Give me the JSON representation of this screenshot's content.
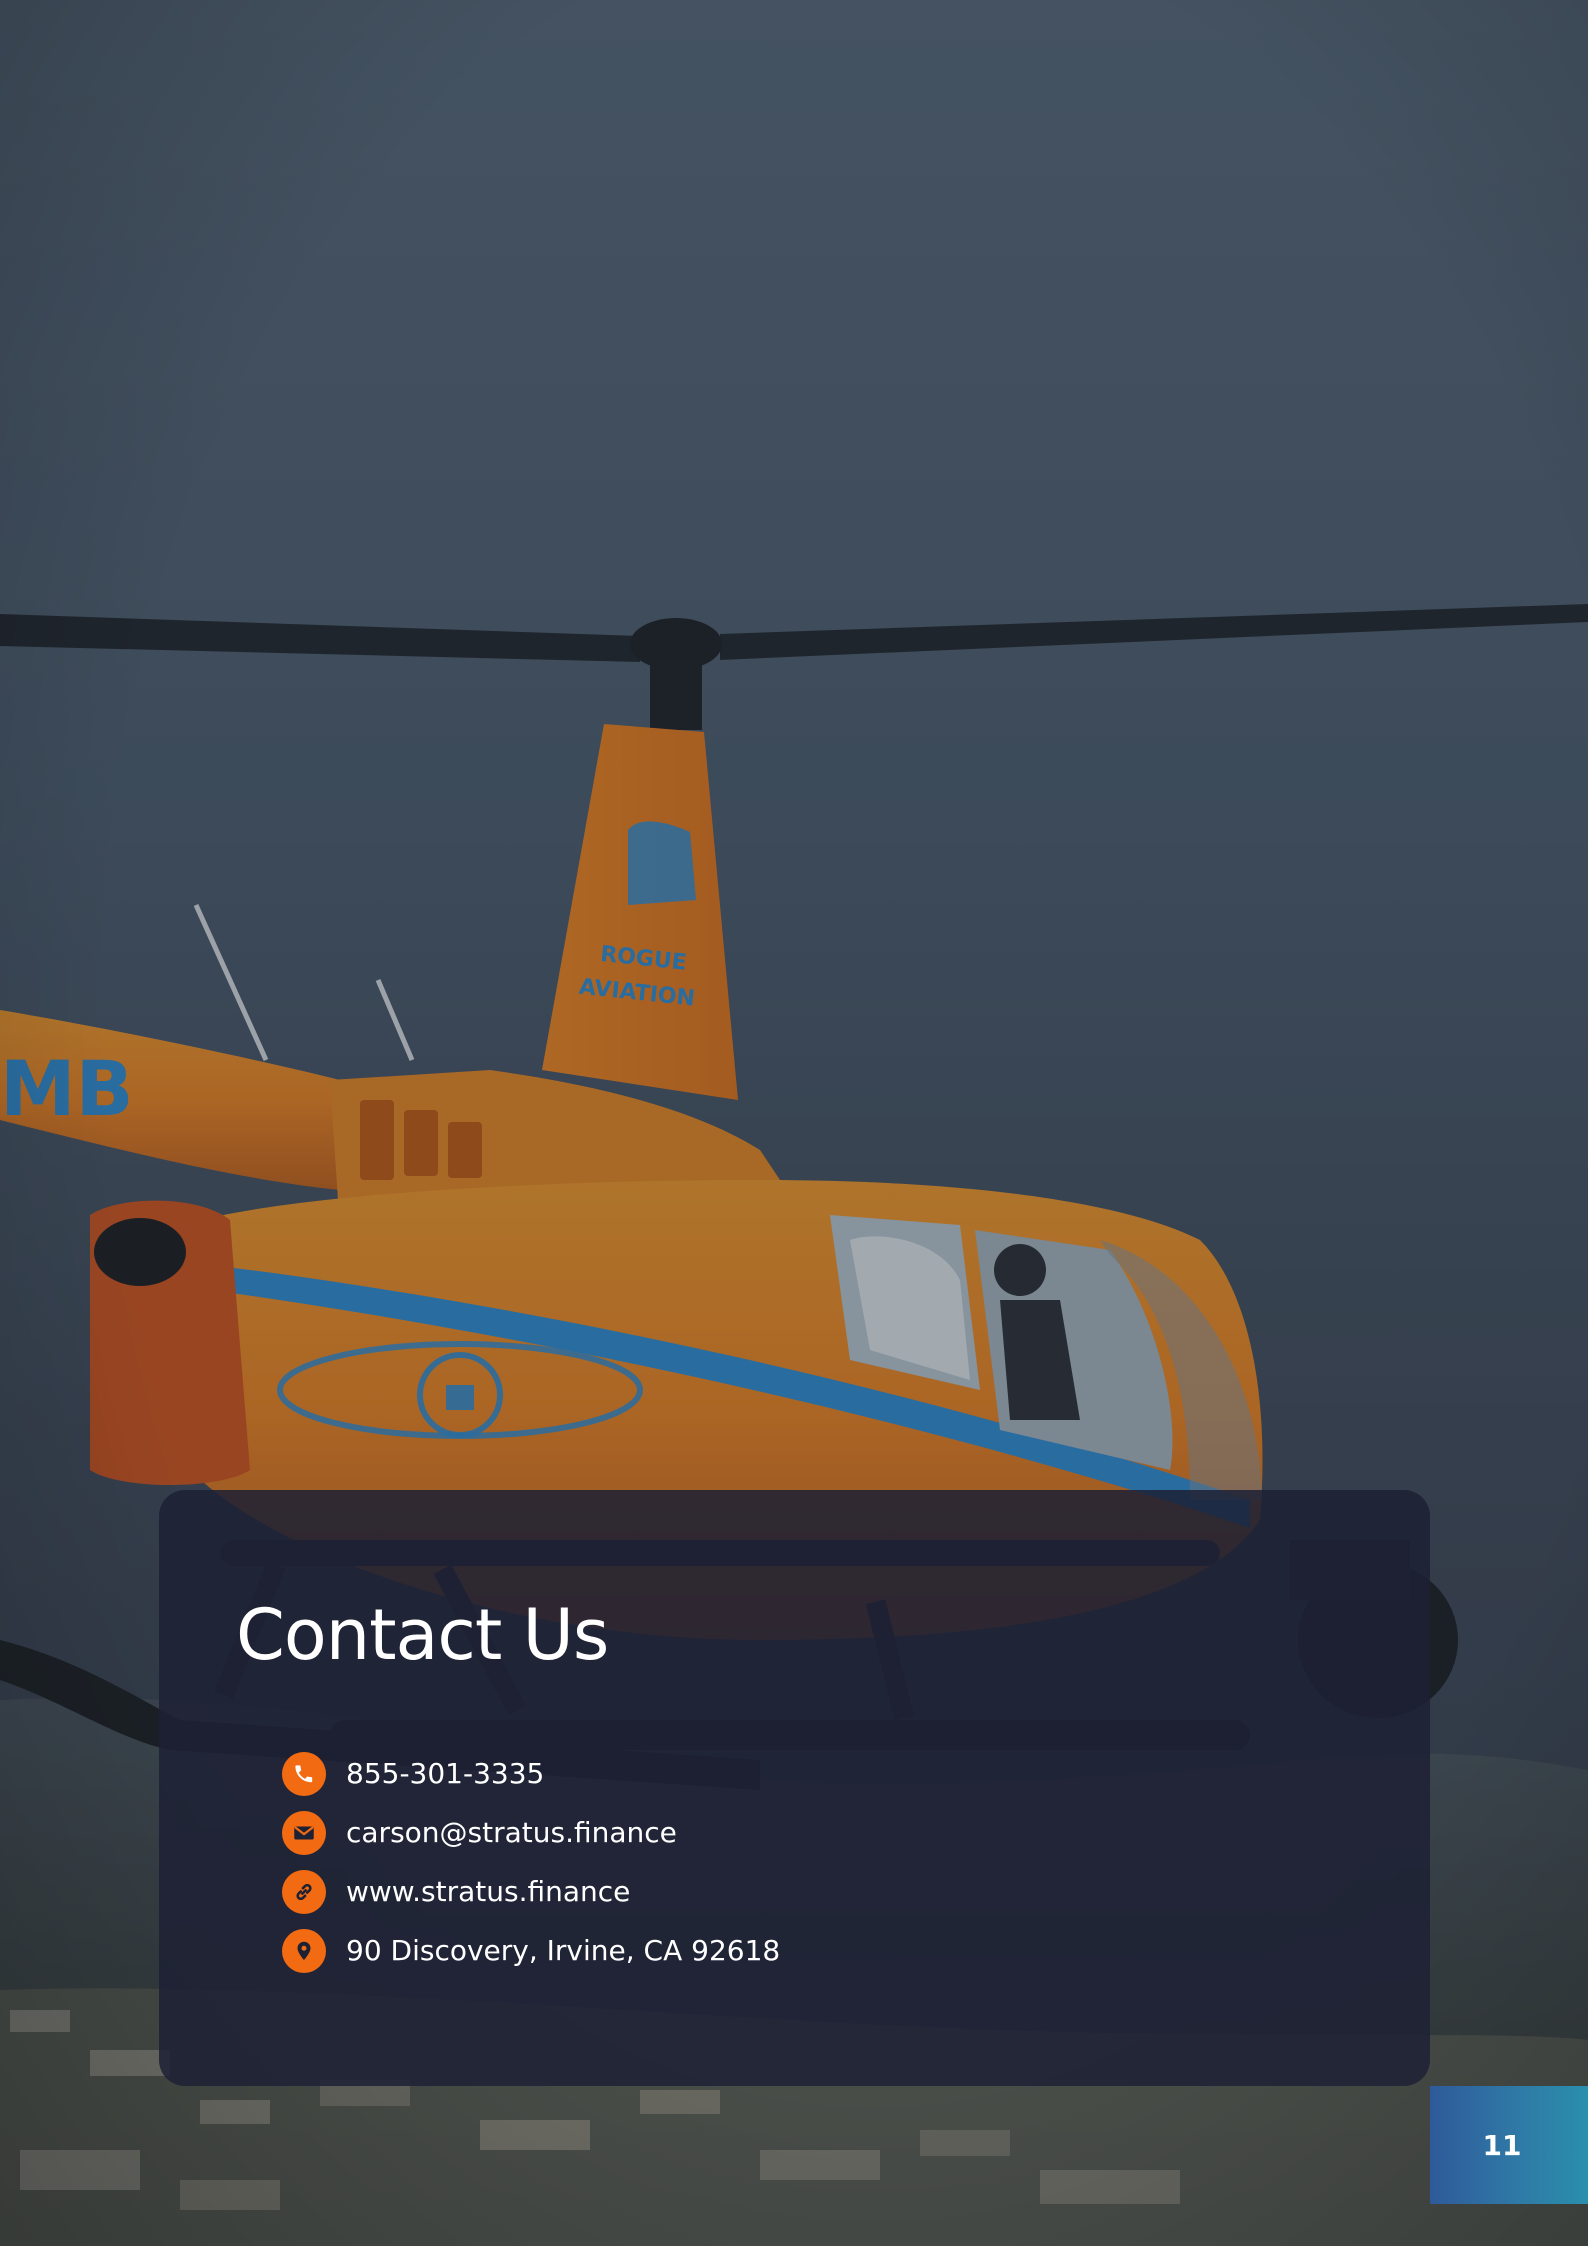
{
  "contact": {
    "title": "Contact Us",
    "items": [
      {
        "icon": "phone-icon",
        "text": "855-301-3335"
      },
      {
        "icon": "mail-icon",
        "text": "carson@stratus.finance"
      },
      {
        "icon": "link-icon",
        "text": "www.stratus.finance"
      },
      {
        "icon": "location-pin-icon",
        "text": "90 Discovery, Irvine, CA 92618"
      }
    ]
  },
  "page": {
    "number": "11"
  },
  "colors": {
    "accent": "#f26b12",
    "card": "#1d2134",
    "page_tab": "#2f79a6",
    "helicopter_body": "#f0861c",
    "helicopter_stripe": "#2f8ed6"
  }
}
